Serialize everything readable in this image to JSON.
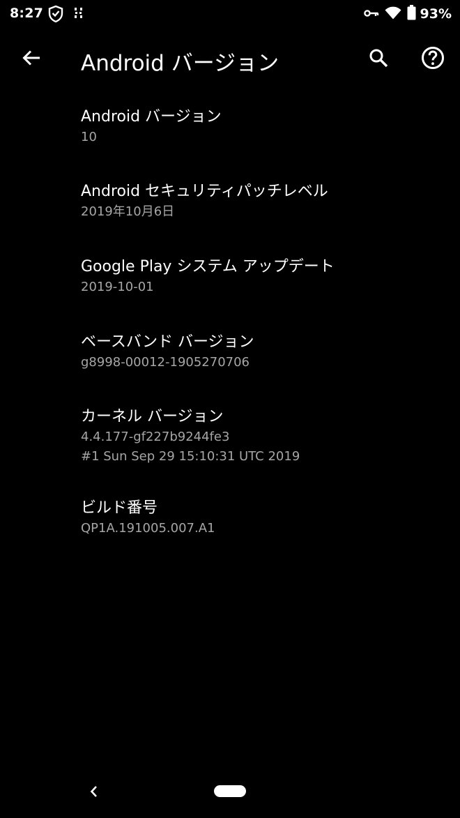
{
  "status_bar": {
    "time": "8:27",
    "battery_percent": "93%",
    "icons": [
      "shield-icon",
      "sim-icon",
      "vpn-key-icon",
      "wifi-icon",
      "battery-icon"
    ]
  },
  "app_bar": {
    "title": "Android バージョン",
    "icons": [
      "back-arrow-icon",
      "search-icon",
      "help-icon"
    ]
  },
  "items": [
    {
      "title": "Android バージョン",
      "value": "10"
    },
    {
      "title": "Android セキュリティパッチレベル",
      "value": "2019年10月6日"
    },
    {
      "title": "Google Play システム アップデート",
      "value": "2019-10-01"
    },
    {
      "title": "ベースバンド バージョン",
      "value": "g8998-00012-1905270706"
    },
    {
      "title": "カーネル バージョン",
      "value": "4.4.177-gf227b9244fe3",
      "value2": "#1 Sun Sep 29 15:10:31 UTC 2019"
    },
    {
      "title": "ビルド番号",
      "value": "QP1A.191005.007.A1"
    }
  ],
  "nav_bar": {
    "icons": [
      "nav-back-icon",
      "home-pill"
    ]
  },
  "colors": {
    "background": "#000000",
    "primary_text": "#ffffff",
    "secondary_text": "#a6a6a6"
  }
}
